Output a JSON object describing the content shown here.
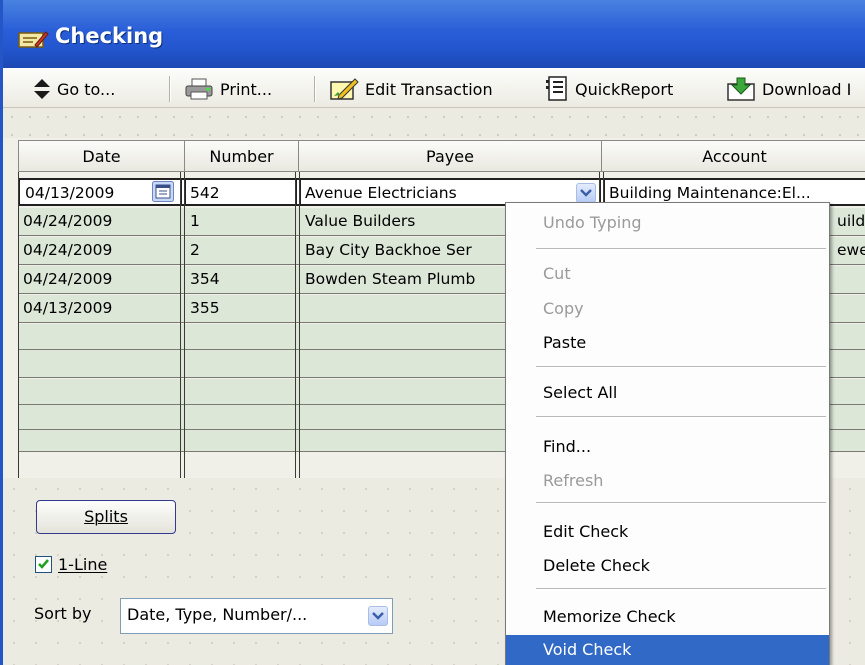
{
  "window": {
    "title": "Checking",
    "title_icon": "checkbook-icon"
  },
  "toolbar": {
    "goto_label": "Go to...",
    "print_label": "Print...",
    "edit_transaction_label": "Edit Transaction",
    "quickreport_label": "QuickReport",
    "download_label": "Download I"
  },
  "table": {
    "columns": [
      "Date",
      "Number",
      "Payee",
      "Account"
    ],
    "rows": [
      {
        "date": "04/13/2009",
        "number": "542",
        "payee": "Avenue Electricians",
        "account": "Building Maintenance:El..."
      },
      {
        "date": "04/24/2009",
        "number": "1",
        "payee": "Value Builders",
        "account": "uildi"
      },
      {
        "date": "04/24/2009",
        "number": "2",
        "payee": "Bay City Backhoe Ser",
        "account": "ewe"
      },
      {
        "date": "04/24/2009",
        "number": "354",
        "payee": "Bowden Steam Plumb",
        "account": ""
      },
      {
        "date": "04/13/2009",
        "number": "355",
        "payee": "",
        "account": ""
      }
    ]
  },
  "bottom": {
    "splits_label": "Splits",
    "one_line_label": "1-Line",
    "one_line_checked": true,
    "sort_by_label": "Sort by",
    "sort_value": "Date, Type, Number/..."
  },
  "context_menu": {
    "items": [
      {
        "label": "Undo Typing",
        "disabled": true
      },
      {
        "label": "Cut",
        "disabled": true
      },
      {
        "label": "Copy",
        "disabled": true
      },
      {
        "label": "Paste",
        "disabled": false
      },
      {
        "label": "Select All",
        "disabled": false
      },
      {
        "label": "Find...",
        "disabled": false
      },
      {
        "label": "Refresh",
        "disabled": true
      },
      {
        "label": "Edit Check",
        "disabled": false
      },
      {
        "label": "Delete Check",
        "disabled": false
      },
      {
        "label": "Memorize Check",
        "disabled": false
      },
      {
        "label": "Void Check",
        "disabled": false,
        "selected": true
      }
    ]
  },
  "colors": {
    "title_bar": "#2a5ed8",
    "row_green": "#dce7d8",
    "menu_highlight": "#3169c6"
  }
}
